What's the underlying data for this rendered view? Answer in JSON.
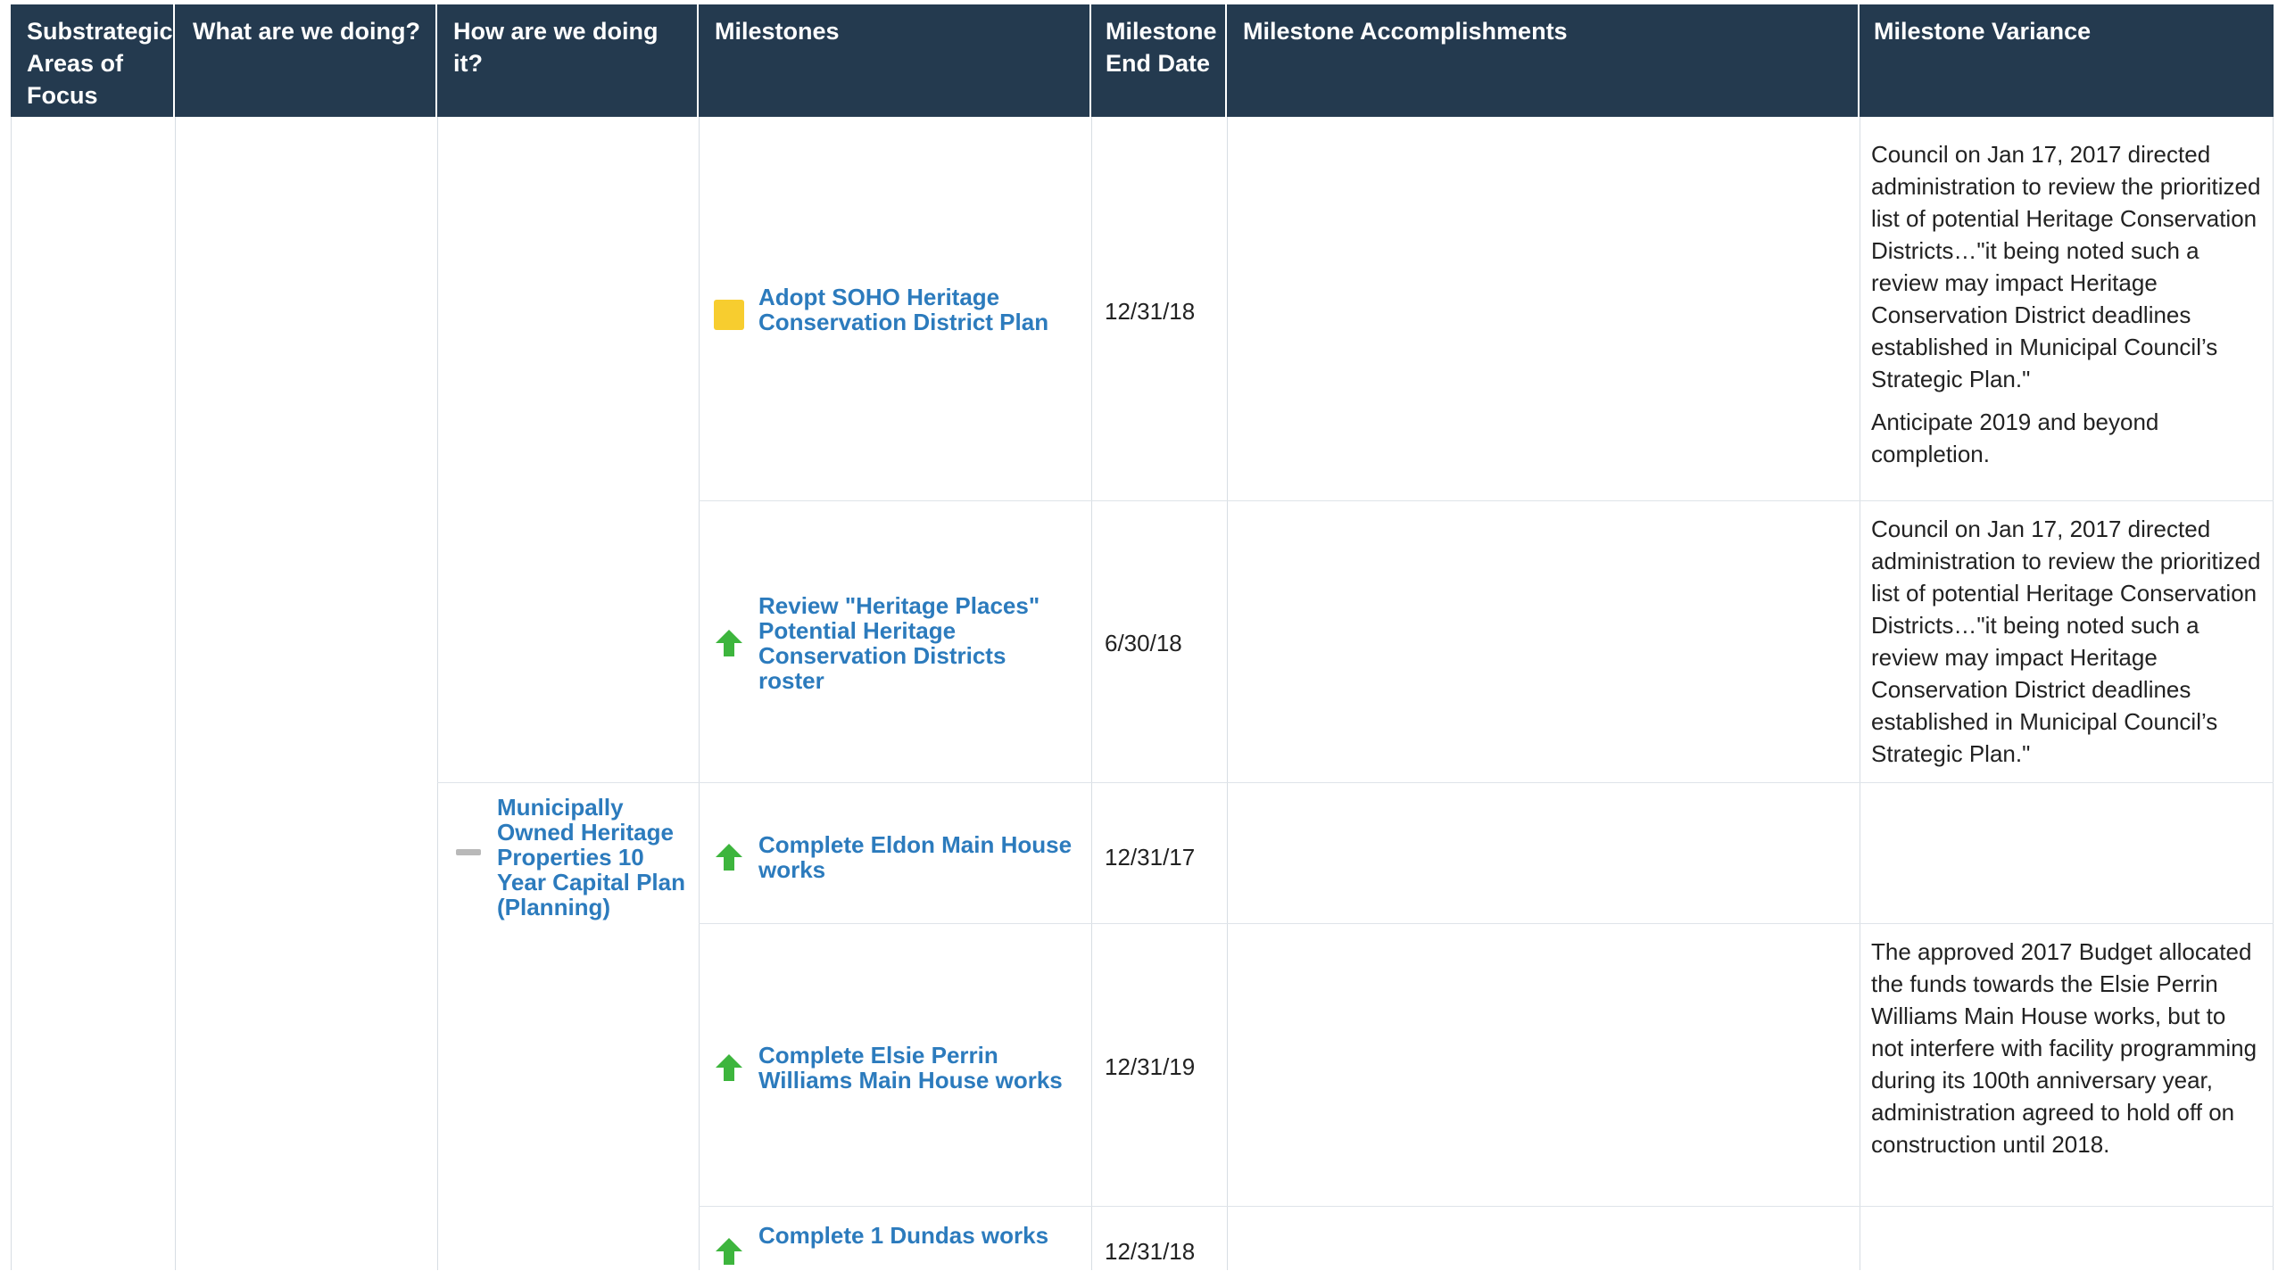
{
  "columns": {
    "substrategic": "Substrategic Areas of Focus",
    "what": "What are we doing?",
    "how": "How are we doing it?",
    "milestones": "Milestones",
    "end_date": "Milestone End Date",
    "accomplishments": "Milestone Accomplishments",
    "variance": "Milestone Variance"
  },
  "how_items": [
    {
      "label": "Municipally Owned Heritage Properties 10 Year Capital Plan (Planning)",
      "status_icon": "gray-dash-icon",
      "status_color": "#b9b9b9"
    }
  ],
  "rows": [
    {
      "milestone": "Adopt SOHO Heritage Conservation District Plan",
      "status_icon": "yellow-square-icon",
      "status_color": "#f7cd2f",
      "end_date": "12/31/18",
      "accomplishments": "",
      "variance": [
        "Council on Jan 17, 2017 directed administration to review the prioritized list of potential Heritage Conservation Districts…\"it being noted such a review may impact Heritage Conservation District deadlines established in Municipal Council’s Strategic Plan.\"",
        "Anticipate 2019 and beyond completion."
      ]
    },
    {
      "milestone": "Review \"Heritage Places\" Potential Heritage Conservation Districts roster",
      "status_icon": "green-up-arrow-icon",
      "status_color": "#3db53d",
      "end_date": "6/30/18",
      "accomplishments": "",
      "variance": [
        "Council on Jan 17, 2017 directed administration to review the prioritized list of potential Heritage Conservation Districts…\"it being noted such a review may impact Heritage Conservation District deadlines established in Municipal Council’s Strategic Plan.\""
      ]
    },
    {
      "milestone": "Complete Eldon Main House works",
      "status_icon": "green-up-arrow-icon",
      "status_color": "#3db53d",
      "end_date": "12/31/17",
      "accomplishments": "",
      "variance": []
    },
    {
      "milestone": "Complete Elsie Perrin Williams Main House works",
      "status_icon": "green-up-arrow-icon",
      "status_color": "#3db53d",
      "end_date": "12/31/19",
      "accomplishments": "",
      "variance": [
        "The approved 2017 Budget allocated the funds towards the Elsie Perrin Williams Main House works, but to not interfere with facility programming during its 100th anniversary year, administration agreed to hold off on construction until 2018."
      ]
    },
    {
      "milestone": "Complete 1 Dundas works",
      "status_icon": "green-up-arrow-icon",
      "status_color": "#3db53d",
      "end_date": "12/31/18",
      "accomplishments": "",
      "variance": []
    }
  ]
}
